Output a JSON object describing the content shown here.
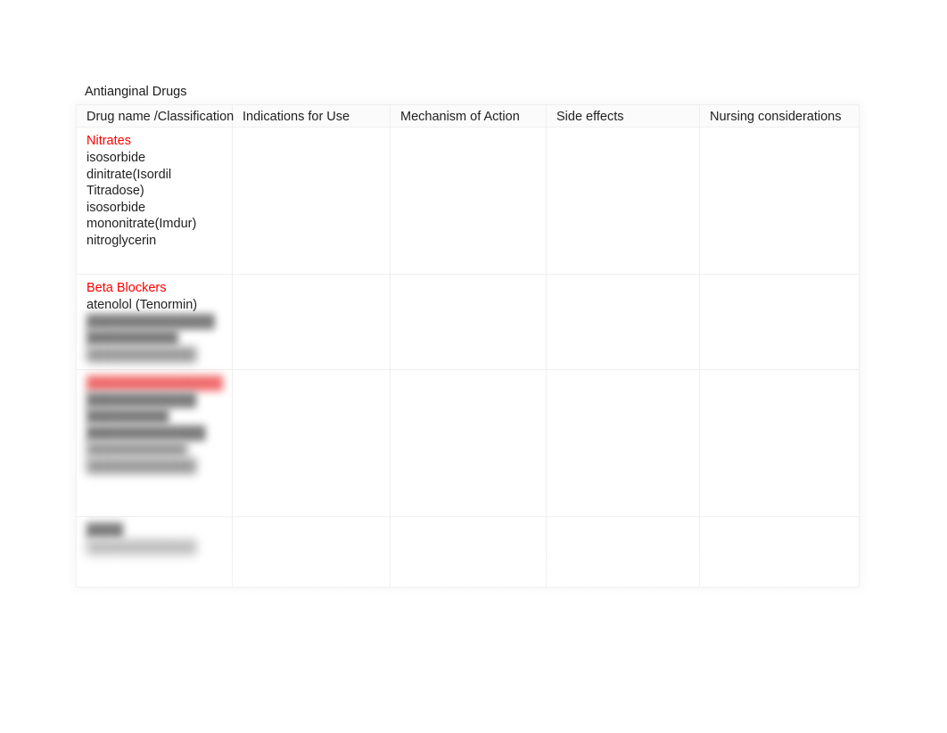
{
  "document": {
    "title": "Antianginal Drugs"
  },
  "table": {
    "columns": [
      "Drug name /Classification",
      "Indications for Use",
      "Mechanism of Action",
      "Side effects",
      "Nursing considerations"
    ],
    "accent_color": "#ff0000",
    "text_color": "#1f1f1f",
    "border_color": "#efefef",
    "rows": [
      {
        "class_heading": "Nitrates",
        "drugs": [
          "isosorbide",
          "dinitrate(Isordil",
          "Titradose)",
          "isosorbide",
          "mononitrate(Imdur)",
          "nitroglycerin"
        ],
        "indications": "",
        "mechanism": "",
        "side_effects": "",
        "nursing": ""
      },
      {
        "class_heading": "Beta Blockers",
        "drugs": [
          "atenolol (Tenormin)"
        ],
        "redacted_lines": [
          "██████████████",
          "██████████",
          "████████████"
        ],
        "indications": "",
        "mechanism": "",
        "side_effects": "",
        "nursing": ""
      },
      {
        "class_heading_redacted": "███████████████",
        "redacted_lines": [
          "████████████",
          "█████████",
          "█████████████",
          "███████████",
          "████████████"
        ],
        "indications": "",
        "mechanism": "",
        "side_effects": "",
        "nursing": ""
      },
      {
        "redacted_lines": [
          "████",
          "████████████"
        ],
        "indications": "",
        "mechanism": "",
        "side_effects": "",
        "nursing": ""
      }
    ]
  }
}
